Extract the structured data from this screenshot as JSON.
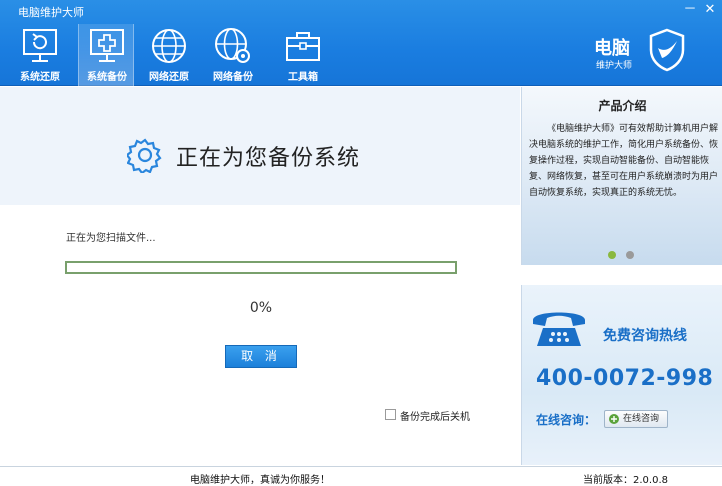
{
  "window": {
    "title": "电脑维护大师",
    "minimize": "－",
    "close": "✕"
  },
  "toolbar": {
    "items": [
      {
        "label": "系统还原",
        "icon": "monitor-restore-icon"
      },
      {
        "label": "系统备份",
        "icon": "monitor-plus-icon",
        "active": true
      },
      {
        "label": "网络还原",
        "icon": "globe-icon"
      },
      {
        "label": "网络备份",
        "icon": "globe-gear-icon"
      },
      {
        "label": "工具箱",
        "icon": "toolbox-icon"
      }
    ]
  },
  "brand": {
    "name": "电脑",
    "sub": "维护大师",
    "icon": "shield-check-icon"
  },
  "main": {
    "title": "正在为您备份系统",
    "status_text": "正在为您扫描文件...",
    "progress_fraction": 0,
    "percent_text": "0%",
    "cancel_label": "取 消",
    "shutdown_label": "备份完成后关机",
    "shutdown_checked": false
  },
  "intro": {
    "title": "产品介绍",
    "text": "《电脑维护大师》可有效帮助计算机用户解决电脑系统的维护工作，简化用户系统备份、恢复操作过程，实现自动智能备份、自动智能恢复、网络恢复，甚至可在用户系统崩溃时为用户自动恢复系统，实现真正的系统无忧。",
    "pager": {
      "count": 2,
      "active_index": 0
    }
  },
  "hotline": {
    "label": "免费咨询热线",
    "number": "400-0072-998",
    "online_label": "在线咨询：",
    "online_button": "在线咨询",
    "icon": "telephone-icon"
  },
  "status_bar": {
    "center_text": "电脑维护大师，真诚为你服务！",
    "version_text": "当前版本：2.0.0.8"
  },
  "colors": {
    "accent": "#1a7de0",
    "hotline_text": "#1a6fc7",
    "progress_border": "#79a06c"
  }
}
